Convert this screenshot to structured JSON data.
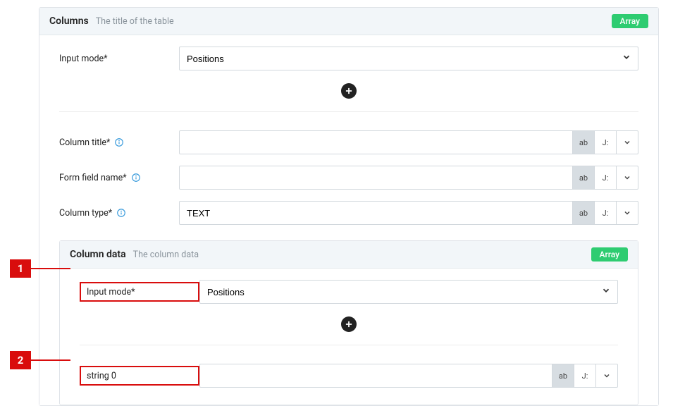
{
  "columns_section": {
    "title": "Columns",
    "subtitle": "The title of the table",
    "badge": "Array",
    "input_mode_label": "Input mode*",
    "input_mode_value": "Positions",
    "column_title_label": "Column title*",
    "column_title_value": "",
    "form_field_name_label": "Form field name*",
    "form_field_name_value": "",
    "column_type_label": "Column type*",
    "column_type_value": "TEXT",
    "ctrl_ab": "ab",
    "ctrl_j": "J:"
  },
  "column_data_section": {
    "title": "Column data",
    "subtitle": "The column data",
    "badge": "Array",
    "input_mode_label": "Input mode*",
    "input_mode_value": "Positions",
    "string0_label": "string 0",
    "string0_value": ""
  },
  "annotations": {
    "m1": "1",
    "m2": "2"
  }
}
